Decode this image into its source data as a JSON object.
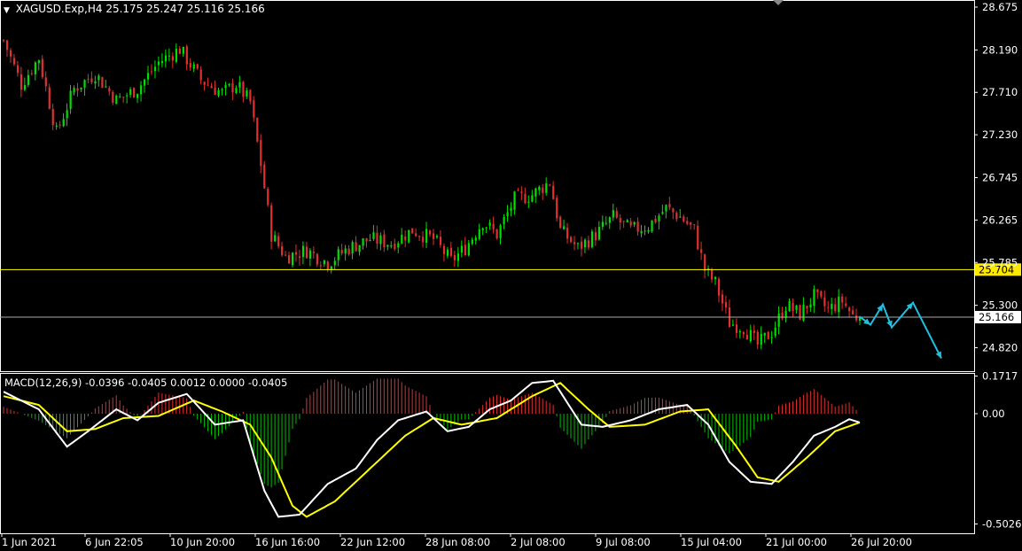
{
  "header": {
    "symbol": "XAGUSD.Exp,H4",
    "ohlc": "25.175 25.247 25.116 25.166"
  },
  "macd_header": {
    "label": "MACD(12,26,9) -0.0396 -0.0405 0.0012 0.0000 -0.0405"
  },
  "colors": {
    "background": "#000000",
    "bull_candle": "#00e000",
    "bear_candle": "#e03030",
    "price_line": "#aaaaaa",
    "level_line": "#ffff00",
    "level_label_bg": "#ffe800",
    "forecast_arrow": "#20c0e0",
    "macd_line": "#ffffff",
    "signal_line": "#ffff00",
    "hist_positive": "#e03030",
    "hist_negative": "#00c000",
    "axis": "#ffffff"
  },
  "chart_data": [
    {
      "type": "candlestick",
      "title": "XAGUSD.Exp,H4",
      "y_ticks": [
        "28.675",
        "28.190",
        "27.710",
        "27.230",
        "26.745",
        "26.265",
        "25.785",
        "25.300",
        "24.820"
      ],
      "ylim": [
        24.68,
        28.72
      ],
      "x_ticks": [
        "1 Jun 2021",
        "6 Jun 22:05",
        "10 Jun 20:00",
        "16 Jun 16:00",
        "22 Jun 12:00",
        "28 Jun 08:00",
        "2 Jul 08:00",
        "9 Jul 08:00",
        "15 Jul 04:00",
        "21 Jul 00:00",
        "26 Jul 20:00"
      ],
      "close_path": [
        {
          "i": 0,
          "v": 28.3
        },
        {
          "i": 5,
          "v": 27.8
        },
        {
          "i": 10,
          "v": 28.1
        },
        {
          "i": 15,
          "v": 27.25
        },
        {
          "i": 20,
          "v": 27.75
        },
        {
          "i": 26,
          "v": 27.92
        },
        {
          "i": 32,
          "v": 27.62
        },
        {
          "i": 38,
          "v": 27.75
        },
        {
          "i": 44,
          "v": 28.05
        },
        {
          "i": 50,
          "v": 28.2
        },
        {
          "i": 56,
          "v": 27.85
        },
        {
          "i": 62,
          "v": 27.7
        },
        {
          "i": 66,
          "v": 27.8
        },
        {
          "i": 70,
          "v": 27.6
        },
        {
          "i": 73,
          "v": 26.9
        },
        {
          "i": 76,
          "v": 26.1
        },
        {
          "i": 80,
          "v": 25.85
        },
        {
          "i": 86,
          "v": 25.92
        },
        {
          "i": 92,
          "v": 25.78
        },
        {
          "i": 98,
          "v": 25.95
        },
        {
          "i": 104,
          "v": 26.05
        },
        {
          "i": 110,
          "v": 26.0
        },
        {
          "i": 116,
          "v": 26.15
        },
        {
          "i": 122,
          "v": 26.05
        },
        {
          "i": 127,
          "v": 25.8
        },
        {
          "i": 131,
          "v": 25.95
        },
        {
          "i": 136,
          "v": 26.25
        },
        {
          "i": 140,
          "v": 26.1
        },
        {
          "i": 145,
          "v": 26.5
        },
        {
          "i": 150,
          "v": 26.55
        },
        {
          "i": 155,
          "v": 26.7
        },
        {
          "i": 158,
          "v": 26.15
        },
        {
          "i": 163,
          "v": 25.95
        },
        {
          "i": 168,
          "v": 26.1
        },
        {
          "i": 173,
          "v": 26.3
        },
        {
          "i": 178,
          "v": 26.15
        },
        {
          "i": 183,
          "v": 26.2
        },
        {
          "i": 188,
          "v": 26.4
        },
        {
          "i": 192,
          "v": 26.3
        },
        {
          "i": 196,
          "v": 26.15
        },
        {
          "i": 199,
          "v": 25.7
        },
        {
          "i": 202,
          "v": 25.55
        },
        {
          "i": 206,
          "v": 25.1
        },
        {
          "i": 210,
          "v": 25.05
        },
        {
          "i": 214,
          "v": 24.85
        },
        {
          "i": 218,
          "v": 25.0
        },
        {
          "i": 222,
          "v": 25.3
        },
        {
          "i": 226,
          "v": 25.2
        },
        {
          "i": 230,
          "v": 25.4
        },
        {
          "i": 234,
          "v": 25.25
        },
        {
          "i": 238,
          "v": 25.35
        },
        {
          "i": 241,
          "v": 25.18
        },
        {
          "i": 243,
          "v": 25.166
        }
      ],
      "current_price": "25.166",
      "level": "25.704",
      "forecast_path": [
        25.17,
        25.08,
        25.31,
        25.05,
        25.33,
        24.7
      ]
    },
    {
      "type": "macd",
      "title": "MACD(12,26,9)",
      "y_ticks": [
        "0.1717",
        "0.00",
        "-0.5026"
      ],
      "ylim": [
        -0.52,
        0.19
      ],
      "macd_path": [
        {
          "i": 0,
          "v": 0.1
        },
        {
          "i": 10,
          "v": 0.02
        },
        {
          "i": 18,
          "v": -0.15
        },
        {
          "i": 24,
          "v": -0.08
        },
        {
          "i": 32,
          "v": 0.02
        },
        {
          "i": 38,
          "v": -0.03
        },
        {
          "i": 44,
          "v": 0.05
        },
        {
          "i": 52,
          "v": 0.09
        },
        {
          "i": 60,
          "v": -0.05
        },
        {
          "i": 68,
          "v": -0.03
        },
        {
          "i": 74,
          "v": -0.35
        },
        {
          "i": 78,
          "v": -0.47
        },
        {
          "i": 84,
          "v": -0.46
        },
        {
          "i": 92,
          "v": -0.32
        },
        {
          "i": 100,
          "v": -0.25
        },
        {
          "i": 106,
          "v": -0.12
        },
        {
          "i": 112,
          "v": -0.03
        },
        {
          "i": 120,
          "v": 0.01
        },
        {
          "i": 126,
          "v": -0.08
        },
        {
          "i": 132,
          "v": -0.06
        },
        {
          "i": 138,
          "v": 0.02
        },
        {
          "i": 144,
          "v": 0.06
        },
        {
          "i": 150,
          "v": 0.14
        },
        {
          "i": 156,
          "v": 0.15
        },
        {
          "i": 164,
          "v": -0.05
        },
        {
          "i": 170,
          "v": -0.06
        },
        {
          "i": 178,
          "v": -0.03
        },
        {
          "i": 186,
          "v": 0.02
        },
        {
          "i": 194,
          "v": 0.04
        },
        {
          "i": 200,
          "v": -0.05
        },
        {
          "i": 206,
          "v": -0.22
        },
        {
          "i": 212,
          "v": -0.31
        },
        {
          "i": 218,
          "v": -0.32
        },
        {
          "i": 224,
          "v": -0.22
        },
        {
          "i": 230,
          "v": -0.1
        },
        {
          "i": 236,
          "v": -0.06
        },
        {
          "i": 240,
          "v": -0.025
        },
        {
          "i": 243,
          "v": -0.04
        }
      ],
      "signal_path": [
        {
          "i": 0,
          "v": 0.08
        },
        {
          "i": 10,
          "v": 0.04
        },
        {
          "i": 18,
          "v": -0.08
        },
        {
          "i": 26,
          "v": -0.07
        },
        {
          "i": 34,
          "v": -0.02
        },
        {
          "i": 44,
          "v": -0.01
        },
        {
          "i": 54,
          "v": 0.06
        },
        {
          "i": 62,
          "v": 0.01
        },
        {
          "i": 70,
          "v": -0.05
        },
        {
          "i": 76,
          "v": -0.2
        },
        {
          "i": 82,
          "v": -0.42
        },
        {
          "i": 86,
          "v": -0.47
        },
        {
          "i": 94,
          "v": -0.4
        },
        {
          "i": 104,
          "v": -0.25
        },
        {
          "i": 114,
          "v": -0.1
        },
        {
          "i": 122,
          "v": -0.02
        },
        {
          "i": 130,
          "v": -0.05
        },
        {
          "i": 140,
          "v": -0.02
        },
        {
          "i": 150,
          "v": 0.08
        },
        {
          "i": 158,
          "v": 0.14
        },
        {
          "i": 166,
          "v": 0.02
        },
        {
          "i": 172,
          "v": -0.06
        },
        {
          "i": 182,
          "v": -0.05
        },
        {
          "i": 192,
          "v": 0.01
        },
        {
          "i": 200,
          "v": 0.02
        },
        {
          "i": 208,
          "v": -0.15
        },
        {
          "i": 214,
          "v": -0.29
        },
        {
          "i": 220,
          "v": -0.31
        },
        {
          "i": 228,
          "v": -0.2
        },
        {
          "i": 236,
          "v": -0.08
        },
        {
          "i": 243,
          "v": -0.04
        }
      ]
    }
  ]
}
